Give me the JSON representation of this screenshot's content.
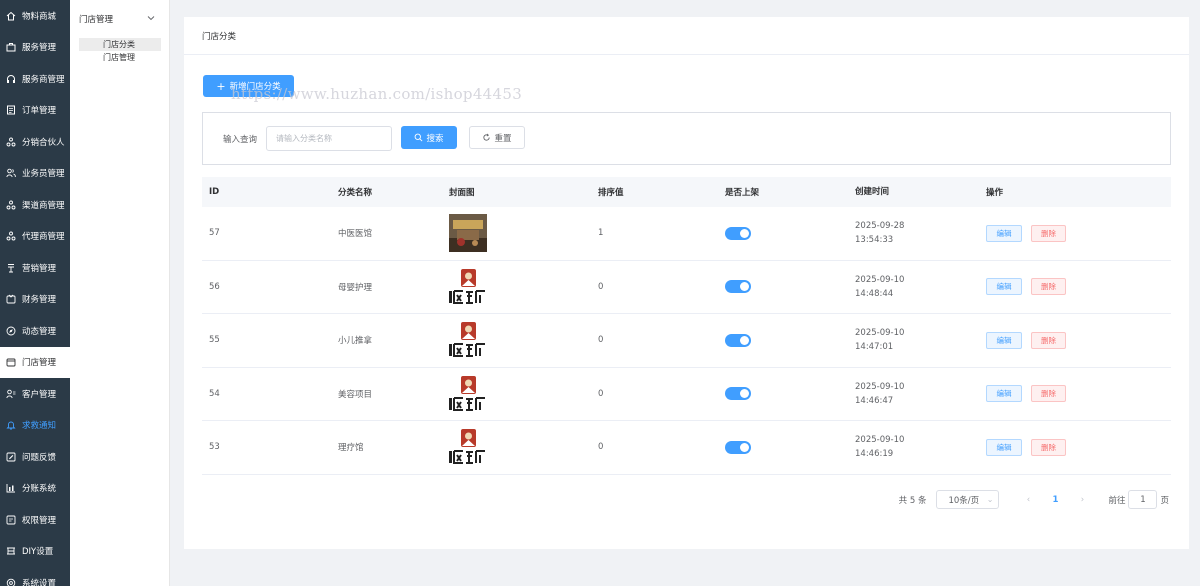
{
  "sidebar": {
    "items": [
      {
        "label": "物料商城",
        "icon": "home-icon"
      },
      {
        "label": "服务管理",
        "icon": "briefcase-icon"
      },
      {
        "label": "服务商管理",
        "icon": "headset-icon"
      },
      {
        "label": "订单管理",
        "icon": "order-icon"
      },
      {
        "label": "分销合伙人",
        "icon": "partner-icon"
      },
      {
        "label": "业务员管理",
        "icon": "users-icon"
      },
      {
        "label": "渠道商管理",
        "icon": "channel-icon"
      },
      {
        "label": "代理商管理",
        "icon": "agent-icon"
      },
      {
        "label": "营销管理",
        "icon": "marketing-icon"
      },
      {
        "label": "财务管理",
        "icon": "finance-icon"
      },
      {
        "label": "动态管理",
        "icon": "compass-icon"
      },
      {
        "label": "门店管理",
        "icon": "store-icon"
      },
      {
        "label": "客户管理",
        "icon": "customer-icon"
      },
      {
        "label": "求救通知",
        "icon": "bell-icon"
      },
      {
        "label": "问题反馈",
        "icon": "feedback-icon"
      },
      {
        "label": "分账系统",
        "icon": "split-icon"
      },
      {
        "label": "权限管理",
        "icon": "key-icon"
      },
      {
        "label": "DIY设置",
        "icon": "diy-icon"
      },
      {
        "label": "系统设置",
        "icon": "settings-icon"
      }
    ]
  },
  "submenu": {
    "title": "门店管理",
    "children": [
      "门店分类",
      "门店管理"
    ]
  },
  "main": {
    "header": "门店分类",
    "add_label": "新增门店分类",
    "watermark": "https://www.huzhan.com/ishop44453",
    "search": {
      "label": "输入查询",
      "placeholder": "请输入分类名称",
      "value": "",
      "search_label": "搜索",
      "reset_label": "重置"
    },
    "table": {
      "headers": [
        "ID",
        "分类名称",
        "封面图",
        "排序值",
        "是否上架",
        "创建时间",
        "操作"
      ],
      "rows": [
        {
          "id": "57",
          "name": "中医医馆",
          "sort": "1",
          "on_shelf": true,
          "date": "2025-09-28",
          "time": "13:54:33",
          "cover": "cover-image-a"
        },
        {
          "id": "56",
          "name": "母婴护理",
          "sort": "0",
          "on_shelf": true,
          "date": "2025-09-10",
          "time": "14:48:44",
          "cover": "cover-image-b"
        },
        {
          "id": "55",
          "name": "小儿推拿",
          "sort": "0",
          "on_shelf": true,
          "date": "2025-09-10",
          "time": "14:47:01",
          "cover": "cover-image-b"
        },
        {
          "id": "54",
          "name": "美容项目",
          "sort": "0",
          "on_shelf": true,
          "date": "2025-09-10",
          "time": "14:46:47",
          "cover": "cover-image-b"
        },
        {
          "id": "53",
          "name": "理疗馆",
          "sort": "0",
          "on_shelf": true,
          "date": "2025-09-10",
          "time": "14:46:19",
          "cover": "cover-image-b"
        }
      ],
      "edit_label": "编辑",
      "delete_label": "删除"
    },
    "pagination": {
      "total": "共 5 条",
      "page_size": "10条/页",
      "current": "1",
      "goto_label": "前往",
      "goto_value": "1",
      "page_suffix": "页"
    }
  },
  "colors": {
    "sidebar_bg": "#2b3a47",
    "primary": "#409eff",
    "danger": "#f56c6c",
    "highlight_item": "#409eff"
  }
}
